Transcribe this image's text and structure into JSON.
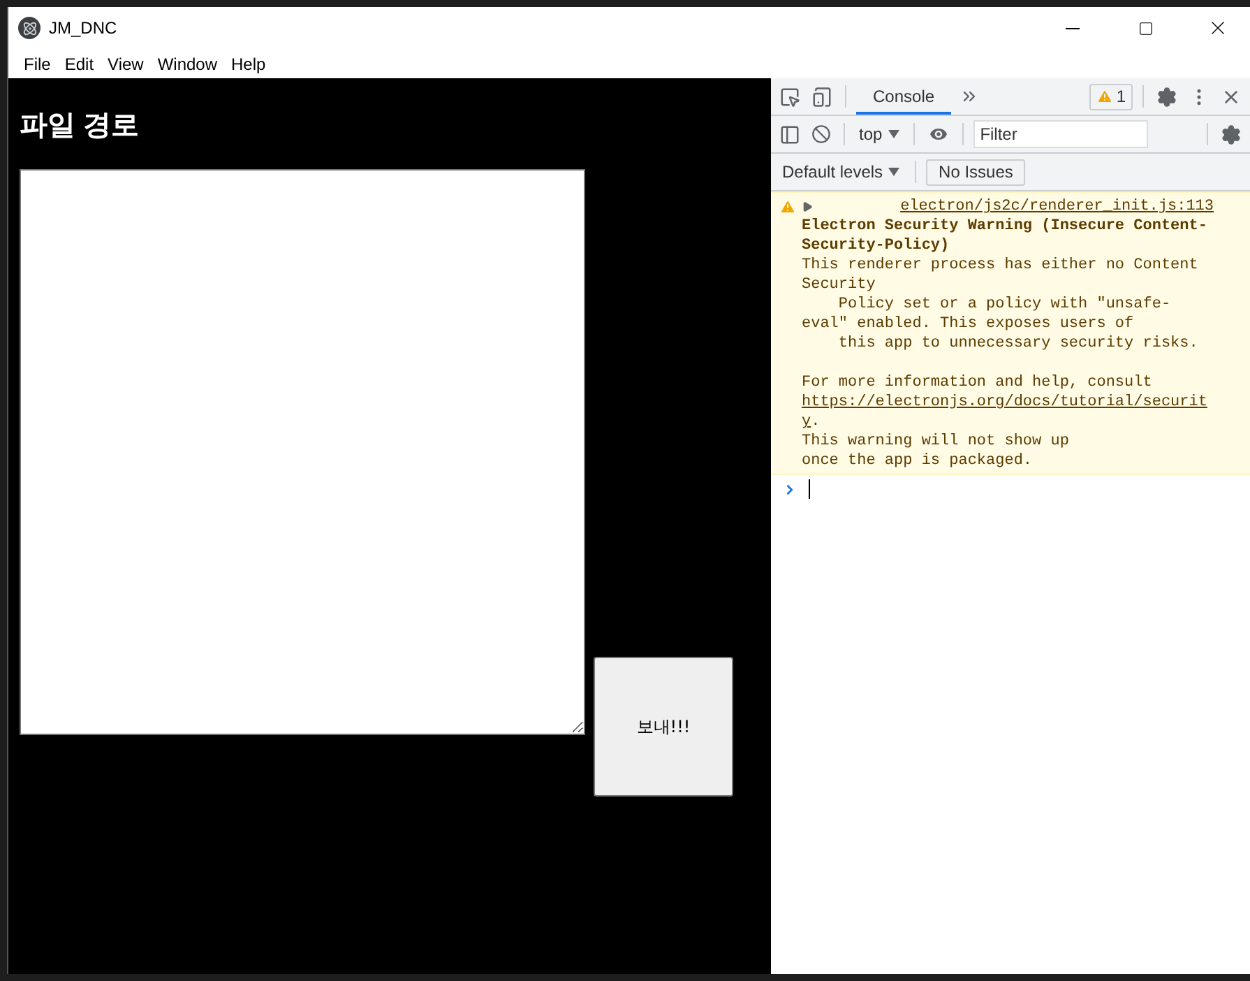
{
  "window": {
    "title": "JM_DNC"
  },
  "menu": [
    "File",
    "Edit",
    "View",
    "Window",
    "Help"
  ],
  "app": {
    "heading": "파일 경로",
    "send_button": "보내!!!"
  },
  "devtools": {
    "tabs": [
      {
        "label": "Console",
        "selected": true
      }
    ],
    "warning_count": "1",
    "context": "top",
    "filter": {
      "placeholder": "Filter"
    },
    "levels": "Default levels",
    "issues": "No Issues",
    "messages": [
      {
        "kind": "warning",
        "expanded": false,
        "source": "electron/js2c/renderer_init.js:113",
        "title": "Electron Security Warning (Insecure Content-\nSecurity-Policy)",
        "body": "This renderer process has either no Content\nSecurity\n    Policy set or a policy with \"unsafe-\neval\" enabled. This exposes users of\n    this app to unnecessary security risks.\n\nFor more information and help, consult",
        "link": "https://electronjs.org/docs/tutorial/securit\ny",
        "link_after": ".",
        "footer": "This warning will not show up\nonce the app is packaged."
      }
    ]
  }
}
